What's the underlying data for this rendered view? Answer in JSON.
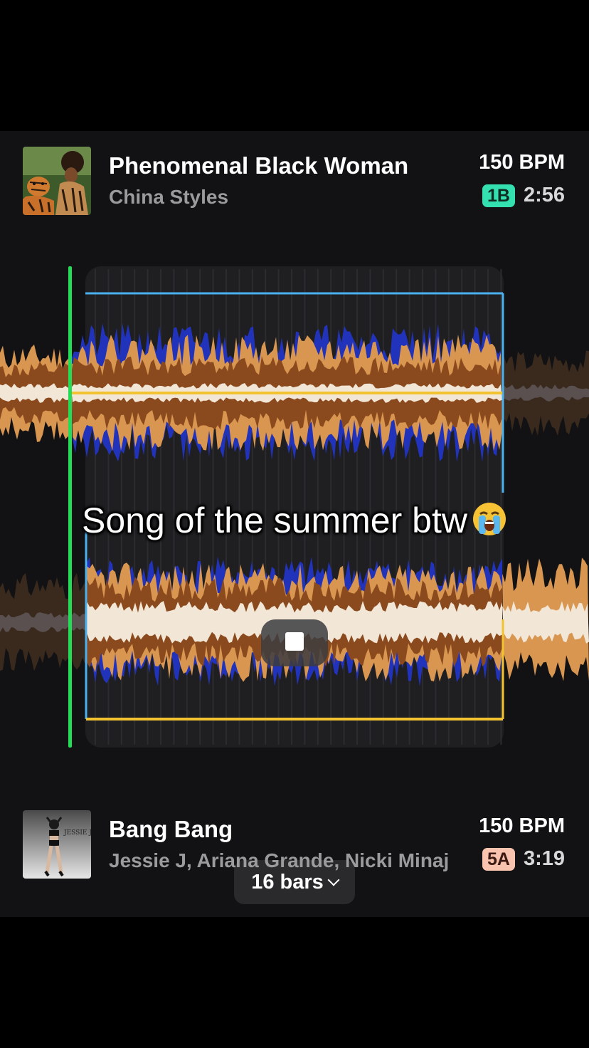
{
  "colors": {
    "background": "#121214",
    "accent_green": "#35e0b0",
    "playhead": "#22dd55",
    "loop_blue": "#4ab0ee",
    "loop_yellow": "#f2c230",
    "wave_brown": "#8a4a1e",
    "wave_orange": "#d99650",
    "wave_blue": "#2233bb",
    "wave_cream": "#f2e6d6"
  },
  "top_track": {
    "title": "Phenomenal Black Woman",
    "artist": "China Styles",
    "bpm": "150 BPM",
    "key": "1B",
    "duration": "2:56",
    "cover_icon": "album-art-woman-with-tiger"
  },
  "bottom_track": {
    "title": "Bang Bang",
    "artist": "Jessie J, Ariana Grande, Nicki Minaj",
    "bpm": "150 BPM",
    "key": "5A",
    "duration": "3:19",
    "cover_icon": "album-art-jessie-j",
    "cover_text": "JESSIE J"
  },
  "mixer": {
    "loop_length": "16 bars",
    "stop_icon": "stop-icon",
    "chevron_icon": "chevron-down-icon"
  },
  "caption": {
    "text": "Song of the summer btw",
    "emoji_icon": "loudly-crying-face-icon"
  }
}
